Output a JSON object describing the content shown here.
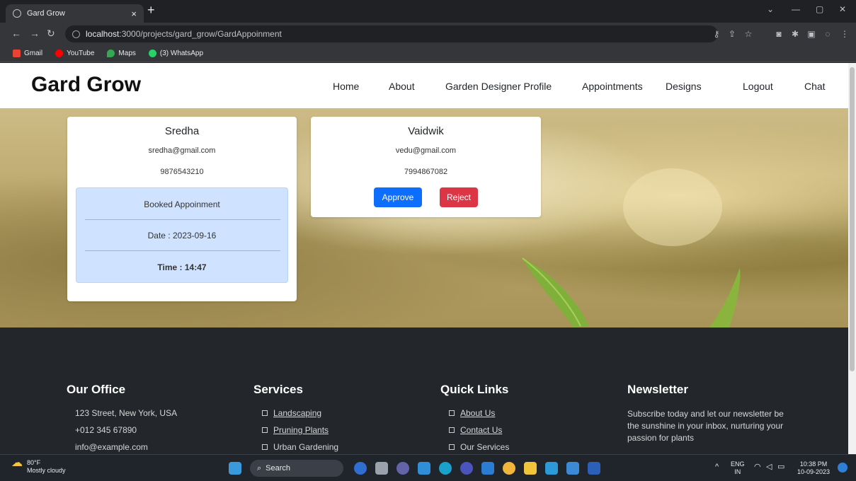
{
  "browser": {
    "tab_title": "Gard Grow",
    "tab_close": "×",
    "new_tab": "+",
    "url_host": "localhost",
    "url_path": ":3000/projects/gard_grow/GardAppoinment",
    "bookmarks": [
      "Gmail",
      "YouTube",
      "Maps",
      "(3) WhatsApp"
    ]
  },
  "site": {
    "brand": "Gard Grow",
    "nav": [
      "Home",
      "About",
      "Garden Designer Profile",
      "Appointments",
      "Designs",
      "Logout",
      "Chat"
    ]
  },
  "designer_card": {
    "name": "Sredha",
    "email": "sredha@gmail.com",
    "phone": "9876543210",
    "booked_label": "Booked Appoinment",
    "date": "Date : 2023-09-16",
    "time": "Time : 14:47"
  },
  "customer_card": {
    "name": "Vaidwik",
    "email": "vedu@gmail.com",
    "phone": "7994867082",
    "approve": "Approve",
    "reject": "Reject"
  },
  "footer": {
    "office": {
      "heading": "Our Office",
      "items": [
        "123 Street, New York, USA",
        "+012 345 67890",
        "info@example.com"
      ]
    },
    "services": {
      "heading": "Services",
      "items": [
        "Landscaping",
        "Pruning Plants",
        "Urban Gardening"
      ]
    },
    "quick_links": {
      "heading": "Quick Links",
      "items": [
        "About Us",
        "Contact Us",
        "Our Services"
      ]
    },
    "newsletter": {
      "heading": "Newsletter",
      "text": "Subscribe today and let our newsletter be the sunshine in your inbox, nurturing your passion for plants"
    }
  },
  "taskbar": {
    "temp": "80°F",
    "weather": "Mostly cloudy",
    "search": "Search",
    "lang": "ENG",
    "region": "IN",
    "time": "10:38 PM",
    "date": "10-09-2023"
  },
  "colors": {
    "approve": "#0d6efd",
    "reject": "#dc3545",
    "booked_bg": "#cfe2ff",
    "footer_bg": "#23272b"
  }
}
